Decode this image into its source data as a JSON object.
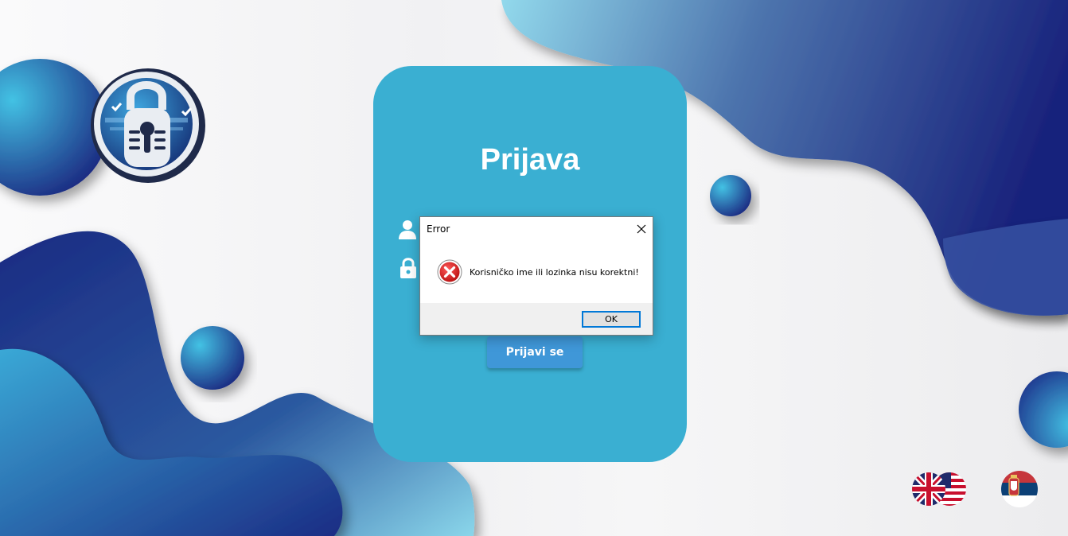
{
  "login": {
    "title": "Prijava",
    "submit_label": "Prijavi se"
  },
  "dialog": {
    "title": "Error",
    "message": "Korisničko ime ili lozinka nisu korektni!",
    "ok_label": "OK"
  },
  "icons": {
    "logo": "padlock-logo",
    "username": "user-icon",
    "password": "lock-icon",
    "error": "error-circle-icon",
    "close": "close-icon"
  },
  "languages": [
    {
      "code": "en",
      "icon": "uk-us-flag-icon"
    },
    {
      "code": "sr",
      "icon": "serbia-flag-icon"
    }
  ],
  "colors": {
    "card": "#3aafd2",
    "button": "#3f97d8",
    "blob_dark": "#1b2c84",
    "blob_light": "#3fb8de"
  }
}
